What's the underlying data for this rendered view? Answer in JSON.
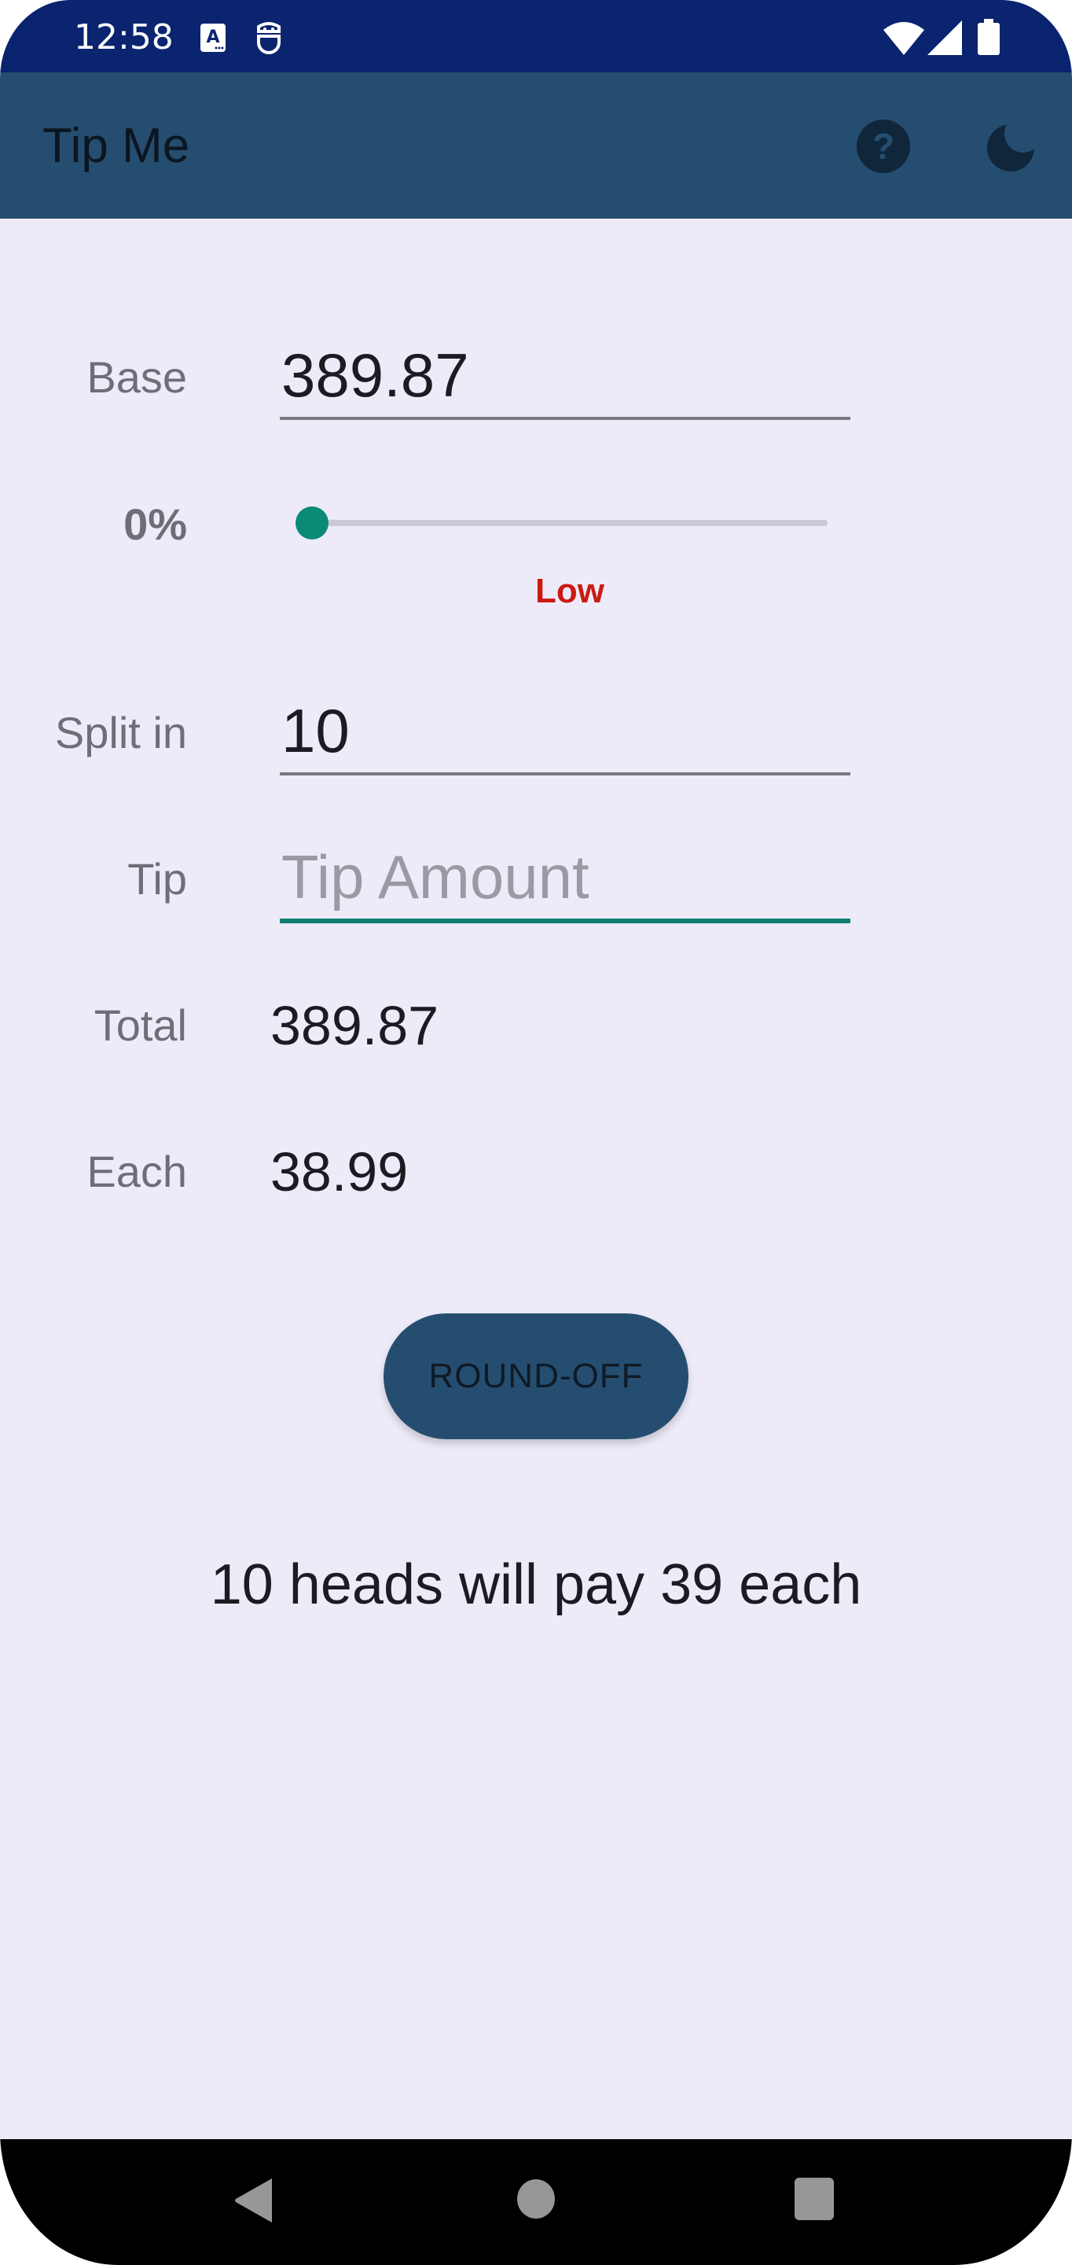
{
  "status_bar": {
    "time": "12:58",
    "left_icons": [
      "accessibility-app-icon",
      "android-debug-icon"
    ],
    "right_icons": [
      "wifi-icon",
      "cellular-signal-icon",
      "battery-icon"
    ]
  },
  "app_bar": {
    "title": "Tip Me",
    "actions": [
      {
        "name": "help-icon",
        "label": "Help"
      },
      {
        "name": "dark-mode-icon",
        "label": "Dark mode"
      }
    ]
  },
  "form": {
    "base": {
      "label": "Base",
      "value": "389.87"
    },
    "tip_percent": {
      "label": "0%",
      "value_percent": 0,
      "rating": "Low"
    },
    "split": {
      "label": "Split in",
      "value": "10"
    },
    "tip": {
      "label": "Tip",
      "value": "",
      "placeholder": "Tip Amount"
    },
    "total": {
      "label": "Total",
      "value": "389.87"
    },
    "each": {
      "label": "Each",
      "value": "38.99"
    }
  },
  "round_off_button": {
    "label": "ROUND-OFF"
  },
  "summary": "10 heads will pay 39 each",
  "colors": {
    "status_bar": "#0a246f",
    "app_bar": "#254d70",
    "background": "#eeebf9",
    "accent": "#0b8a78",
    "rating_low": "#cc1a12"
  },
  "nav_bar": {
    "buttons": [
      "back",
      "home",
      "recents"
    ]
  }
}
